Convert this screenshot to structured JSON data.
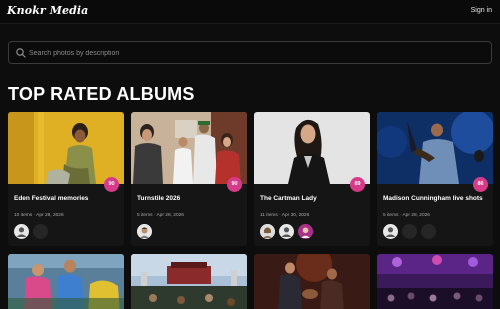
{
  "app": {
    "logo": "Knokr Media",
    "signin_label": "Sign in"
  },
  "search": {
    "placeholder": "Search photos by description",
    "value": ""
  },
  "section": {
    "title": "TOP RATED ALBUMS"
  },
  "albums": [
    {
      "title": "Eden Festival memories",
      "items": "10 items",
      "date": "Apr 28, 2026",
      "rating": "90"
    },
    {
      "title": "Turnstile 2026",
      "items": "5 items",
      "date": "Apr 28, 2026",
      "rating": "90"
    },
    {
      "title": "The Cartman Lady",
      "items": "11 items",
      "date": "Apr 30, 2026",
      "rating": "89"
    },
    {
      "title": "Madison Cunningham live shots",
      "items": "5 items",
      "date": "Apr 28, 2026",
      "rating": "86"
    }
  ],
  "colors": {
    "accent": "#d83a8a",
    "background": "#0d0d0d",
    "card": "#151515"
  },
  "icons": {
    "search": "search-icon",
    "avatar": "user-icon"
  }
}
